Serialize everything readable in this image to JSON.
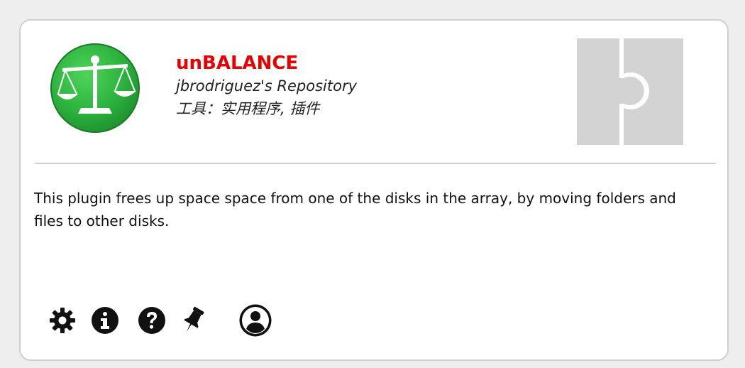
{
  "plugin": {
    "name": "unBALANCE",
    "repository": "jbrodriguez's Repository",
    "category": "工具：实用程序, 插件",
    "description": "This plugin frees up space space from one of the disks in the array, by moving folders and files to other disks."
  },
  "actions": {
    "settings": "gear-icon",
    "info": "info-icon",
    "help": "question-icon",
    "pin": "pin-icon",
    "profile": "user-circle-icon"
  },
  "colors": {
    "title": "#e80000",
    "icon_green": "#2cb33e",
    "placeholder_gray": "#d3d3d3"
  }
}
